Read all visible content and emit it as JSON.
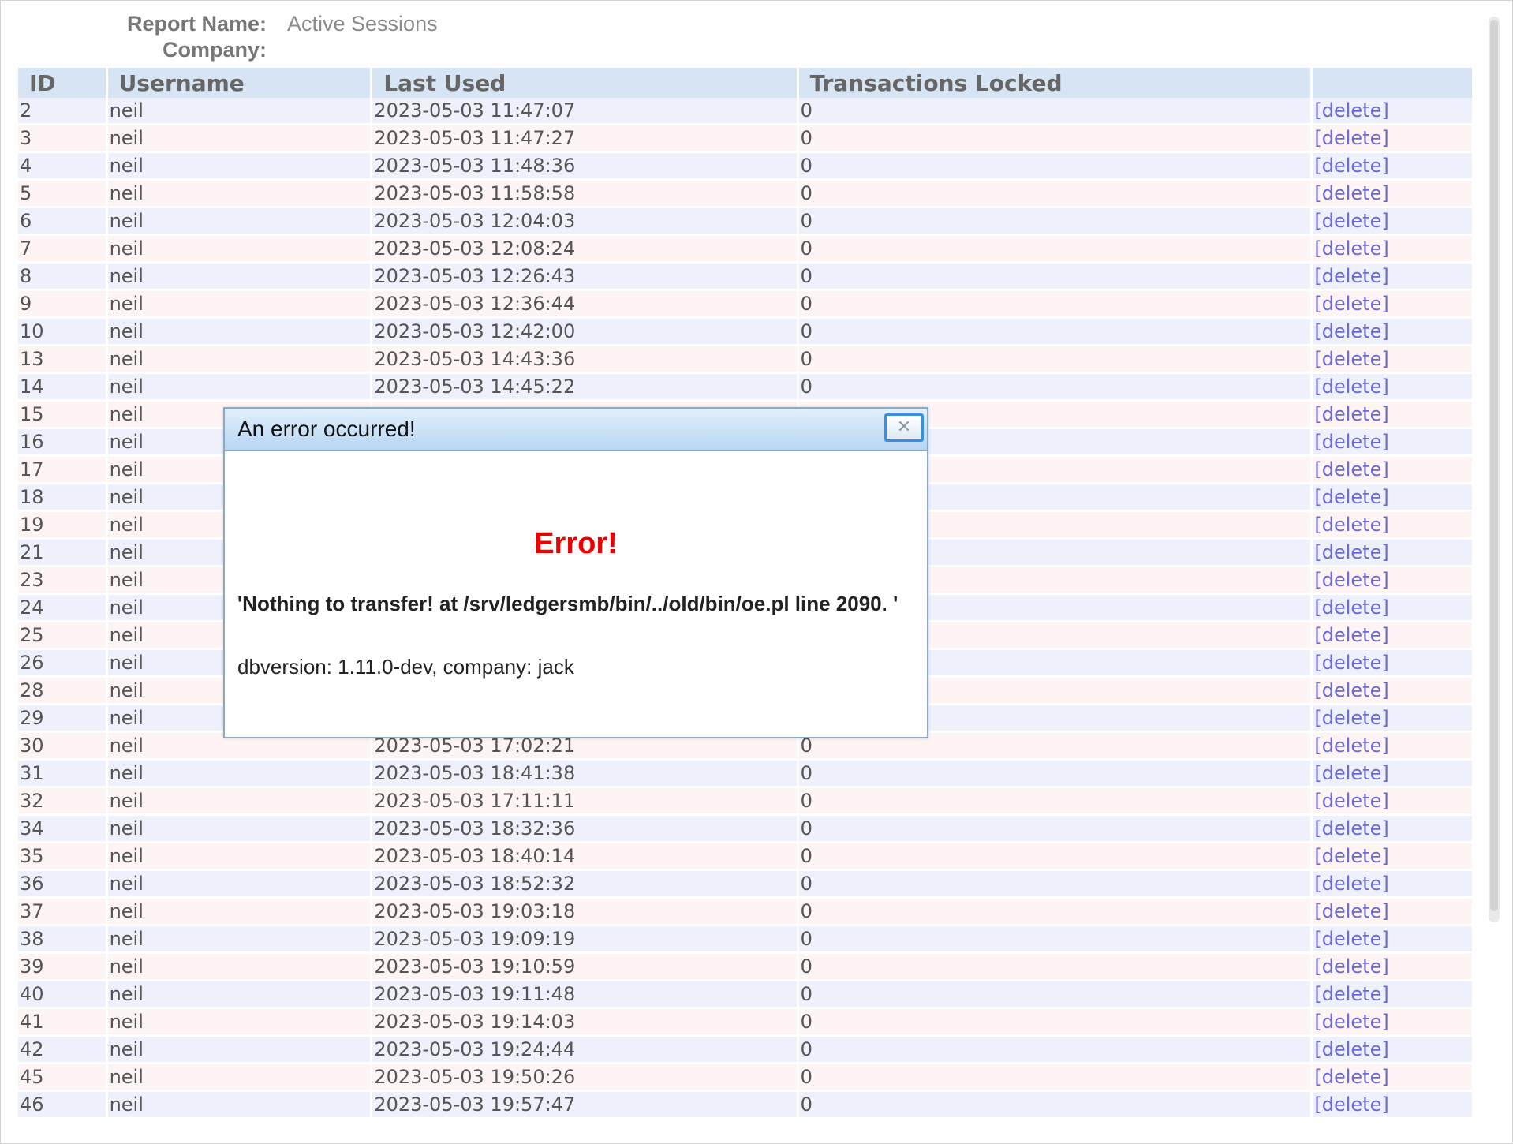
{
  "report": {
    "name_label": "Report Name:",
    "name_value": "Active Sessions",
    "company_label": "Company:",
    "company_value": ""
  },
  "table": {
    "headers": {
      "id": "ID",
      "username": "Username",
      "last_used": "Last Used",
      "transactions_locked": "Transactions Locked",
      "actions": ""
    },
    "delete_label": "[delete]",
    "rows": [
      {
        "id": "2",
        "username": "neil",
        "last_used": "2023-05-03 11:47:07",
        "locked": "0"
      },
      {
        "id": "3",
        "username": "neil",
        "last_used": "2023-05-03 11:47:27",
        "locked": "0"
      },
      {
        "id": "4",
        "username": "neil",
        "last_used": "2023-05-03 11:48:36",
        "locked": "0"
      },
      {
        "id": "5",
        "username": "neil",
        "last_used": "2023-05-03 11:58:58",
        "locked": "0"
      },
      {
        "id": "6",
        "username": "neil",
        "last_used": "2023-05-03 12:04:03",
        "locked": "0"
      },
      {
        "id": "7",
        "username": "neil",
        "last_used": "2023-05-03 12:08:24",
        "locked": "0"
      },
      {
        "id": "8",
        "username": "neil",
        "last_used": "2023-05-03 12:26:43",
        "locked": "0"
      },
      {
        "id": "9",
        "username": "neil",
        "last_used": "2023-05-03 12:36:44",
        "locked": "0"
      },
      {
        "id": "10",
        "username": "neil",
        "last_used": "2023-05-03 12:42:00",
        "locked": "0"
      },
      {
        "id": "13",
        "username": "neil",
        "last_used": "2023-05-03 14:43:36",
        "locked": "0"
      },
      {
        "id": "14",
        "username": "neil",
        "last_used": "2023-05-03 14:45:22",
        "locked": "0"
      },
      {
        "id": "15",
        "username": "neil",
        "last_used": "",
        "locked": ""
      },
      {
        "id": "16",
        "username": "neil",
        "last_used": "",
        "locked": ""
      },
      {
        "id": "17",
        "username": "neil",
        "last_used": "",
        "locked": ""
      },
      {
        "id": "18",
        "username": "neil",
        "last_used": "",
        "locked": ""
      },
      {
        "id": "19",
        "username": "neil",
        "last_used": "",
        "locked": ""
      },
      {
        "id": "21",
        "username": "neil",
        "last_used": "",
        "locked": ""
      },
      {
        "id": "23",
        "username": "neil",
        "last_used": "",
        "locked": ""
      },
      {
        "id": "24",
        "username": "neil",
        "last_used": "",
        "locked": ""
      },
      {
        "id": "25",
        "username": "neil",
        "last_used": "",
        "locked": ""
      },
      {
        "id": "26",
        "username": "neil",
        "last_used": "",
        "locked": ""
      },
      {
        "id": "28",
        "username": "neil",
        "last_used": "",
        "locked": ""
      },
      {
        "id": "29",
        "username": "neil",
        "last_used": "",
        "locked": ""
      },
      {
        "id": "30",
        "username": "neil",
        "last_used": "2023-05-03 17:02:21",
        "locked": "0"
      },
      {
        "id": "31",
        "username": "neil",
        "last_used": "2023-05-03 18:41:38",
        "locked": "0"
      },
      {
        "id": "32",
        "username": "neil",
        "last_used": "2023-05-03 17:11:11",
        "locked": "0"
      },
      {
        "id": "34",
        "username": "neil",
        "last_used": "2023-05-03 18:32:36",
        "locked": "0"
      },
      {
        "id": "35",
        "username": "neil",
        "last_used": "2023-05-03 18:40:14",
        "locked": "0"
      },
      {
        "id": "36",
        "username": "neil",
        "last_used": "2023-05-03 18:52:32",
        "locked": "0"
      },
      {
        "id": "37",
        "username": "neil",
        "last_used": "2023-05-03 19:03:18",
        "locked": "0"
      },
      {
        "id": "38",
        "username": "neil",
        "last_used": "2023-05-03 19:09:19",
        "locked": "0"
      },
      {
        "id": "39",
        "username": "neil",
        "last_used": "2023-05-03 19:10:59",
        "locked": "0"
      },
      {
        "id": "40",
        "username": "neil",
        "last_used": "2023-05-03 19:11:48",
        "locked": "0"
      },
      {
        "id": "41",
        "username": "neil",
        "last_used": "2023-05-03 19:14:03",
        "locked": "0"
      },
      {
        "id": "42",
        "username": "neil",
        "last_used": "2023-05-03 19:24:44",
        "locked": "0"
      },
      {
        "id": "45",
        "username": "neil",
        "last_used": "2023-05-03 19:50:26",
        "locked": "0"
      },
      {
        "id": "46",
        "username": "neil",
        "last_used": "2023-05-03 19:57:47",
        "locked": "0"
      }
    ]
  },
  "dialog": {
    "title": "An error occurred!",
    "close_icon": "close-icon",
    "heading": "Error!",
    "message": "'Nothing to transfer! at /srv/ledgersmb/bin/../old/bin/oe.pl line 2090. '",
    "details": "dbversion: 1.11.0-dev, company: jack"
  },
  "colors": {
    "header_bg": "#d6e4f3",
    "row_odd": "#eef0fb",
    "row_even": "#fff4f4",
    "link": "#6b6bd6",
    "error": "#ee0000",
    "dialog_border": "#8aa9c9"
  }
}
